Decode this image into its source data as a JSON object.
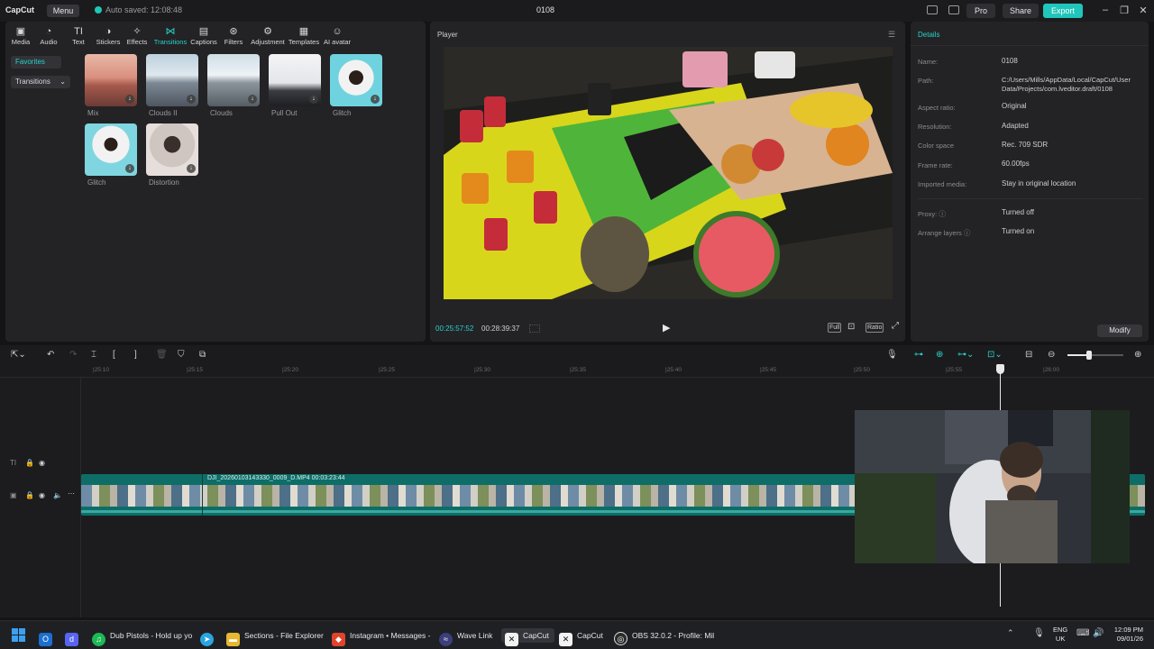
{
  "titlebar": {
    "logo": "CapCut",
    "menu": "Menu",
    "autosave": "Auto saved: 12:08:48",
    "project": "0108",
    "pro": "Pro",
    "share": "Share",
    "export": "Export"
  },
  "tools": [
    {
      "label": "Media",
      "icon": "media-icon"
    },
    {
      "label": "Audio",
      "icon": "audio-icon"
    },
    {
      "label": "Text",
      "icon": "text-icon"
    },
    {
      "label": "Stickers",
      "icon": "stickers-icon"
    },
    {
      "label": "Effects",
      "icon": "effects-icon"
    },
    {
      "label": "Transitions",
      "icon": "transitions-icon"
    },
    {
      "label": "Captions",
      "icon": "captions-icon"
    },
    {
      "label": "Filters",
      "icon": "filters-icon"
    },
    {
      "label": "Adjustment",
      "icon": "adjustment-icon"
    },
    {
      "label": "Templates",
      "icon": "templates-icon"
    },
    {
      "label": "AI avatar",
      "icon": "ai-avatar-icon"
    }
  ],
  "sidebar": {
    "favorites": "Favorites",
    "transitions": "Transitions"
  },
  "transitions": [
    "Mix",
    "Clouds II",
    "Clouds",
    "Pull Out",
    "Glitch",
    "Glitch",
    "Distortion"
  ],
  "player": {
    "title": "Player",
    "current_time": "00:25:57:52",
    "total_time": "00:28:39:37",
    "full": "Full",
    "ratio": "Ratio"
  },
  "details": {
    "title": "Details",
    "rows": [
      {
        "key": "Name:",
        "value": "0108"
      },
      {
        "key": "Path:",
        "value": "C:/Users/Mills/AppData/Local/CapCut/User Data/Projects/com.lveditor.draft/0108"
      },
      {
        "key": "Aspect ratio:",
        "value": "Original"
      },
      {
        "key": "Resolution:",
        "value": "Adapted"
      },
      {
        "key": "Color space",
        "value": "Rec. 709 SDR"
      },
      {
        "key": "Frame rate:",
        "value": "60.00fps"
      },
      {
        "key": "Imported media:",
        "value": "Stay in original location"
      },
      {
        "key": "Proxy:",
        "value": "Turned off"
      },
      {
        "key": "Arrange layers",
        "value": "Turned on"
      }
    ],
    "modify": "Modify"
  },
  "timeline": {
    "ticks": [
      "|25:10",
      "|25:15",
      "|25:20",
      "|25:25",
      "|25:30",
      "|25:35",
      "|25:40",
      "|25:45",
      "|25:50",
      "|25:55",
      "|26:00"
    ],
    "clip_name": "DJI_20260103143330_0009_D.MP4  00:03:23:44"
  },
  "taskbar": {
    "items": [
      "Dub Pistols - Hold up yo",
      "Sections - File Explorer",
      "Instagram • Messages -",
      "Wave Link",
      "CapCut",
      "CapCut",
      "OBS 32.0.2 - Profile: Mil"
    ],
    "lang": "ENG",
    "region": "UK",
    "time": "12:09 PM",
    "date": "09/01/26"
  },
  "colors": {
    "accent": "#20c6bb",
    "bg": "#141416",
    "panel": "#232326"
  }
}
